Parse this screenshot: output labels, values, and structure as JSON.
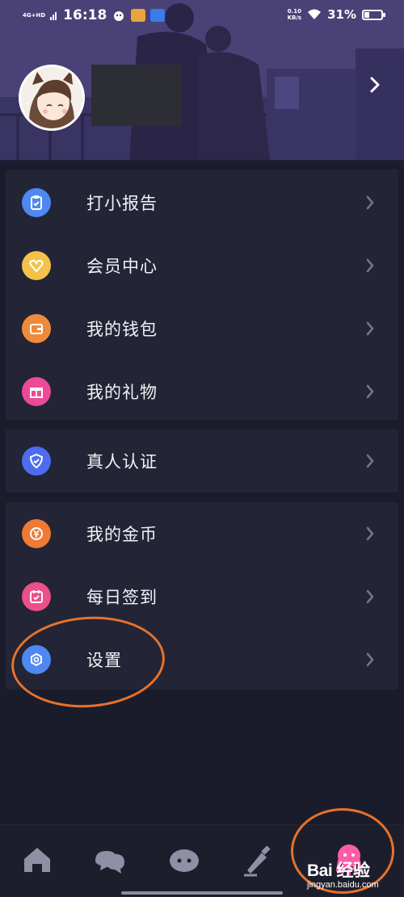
{
  "status_bar": {
    "network": "4G+HD",
    "time": "16:18",
    "speed_value": "0.10",
    "speed_unit": "KB/s",
    "battery": "31%",
    "battery_level": 0.31
  },
  "menu_groups": [
    {
      "items": [
        {
          "label": "打小报告",
          "icon": "clipboard-icon",
          "color": "#4e88f0"
        },
        {
          "label": "会员中心",
          "icon": "vip-heart-icon",
          "color": "#f3c24a"
        },
        {
          "label": "我的钱包",
          "icon": "wallet-icon",
          "color": "#ef8a3c"
        },
        {
          "label": "我的礼物",
          "icon": "gift-icon",
          "color": "#ec4a98"
        }
      ]
    },
    {
      "items": [
        {
          "label": "真人认证",
          "icon": "shield-check-icon",
          "color": "#4e6cf0"
        }
      ]
    },
    {
      "items": [
        {
          "label": "我的金币",
          "icon": "coin-icon",
          "color": "#ef7a34"
        },
        {
          "label": "每日签到",
          "icon": "calendar-check-icon",
          "color": "#ec4f8a"
        },
        {
          "label": "设置",
          "icon": "settings-hexagon-icon",
          "color": "#4e88f0"
        }
      ]
    }
  ],
  "bottom_nav": [
    {
      "name": "home",
      "icon": "home-icon"
    },
    {
      "name": "chat",
      "icon": "chat-bubbles-icon"
    },
    {
      "name": "planet",
      "icon": "planet-face-icon"
    },
    {
      "name": "bottle",
      "icon": "message-bottle-icon"
    },
    {
      "name": "profile",
      "icon": "profile-octopus-icon",
      "active_color": "#ff5ca8"
    }
  ],
  "watermark": {
    "main": "Bai 经验",
    "sub": "jingyan.baidu.com"
  },
  "colors": {
    "background": "#1b1c2b",
    "card": "#232435",
    "annotation": "#e6722c"
  }
}
